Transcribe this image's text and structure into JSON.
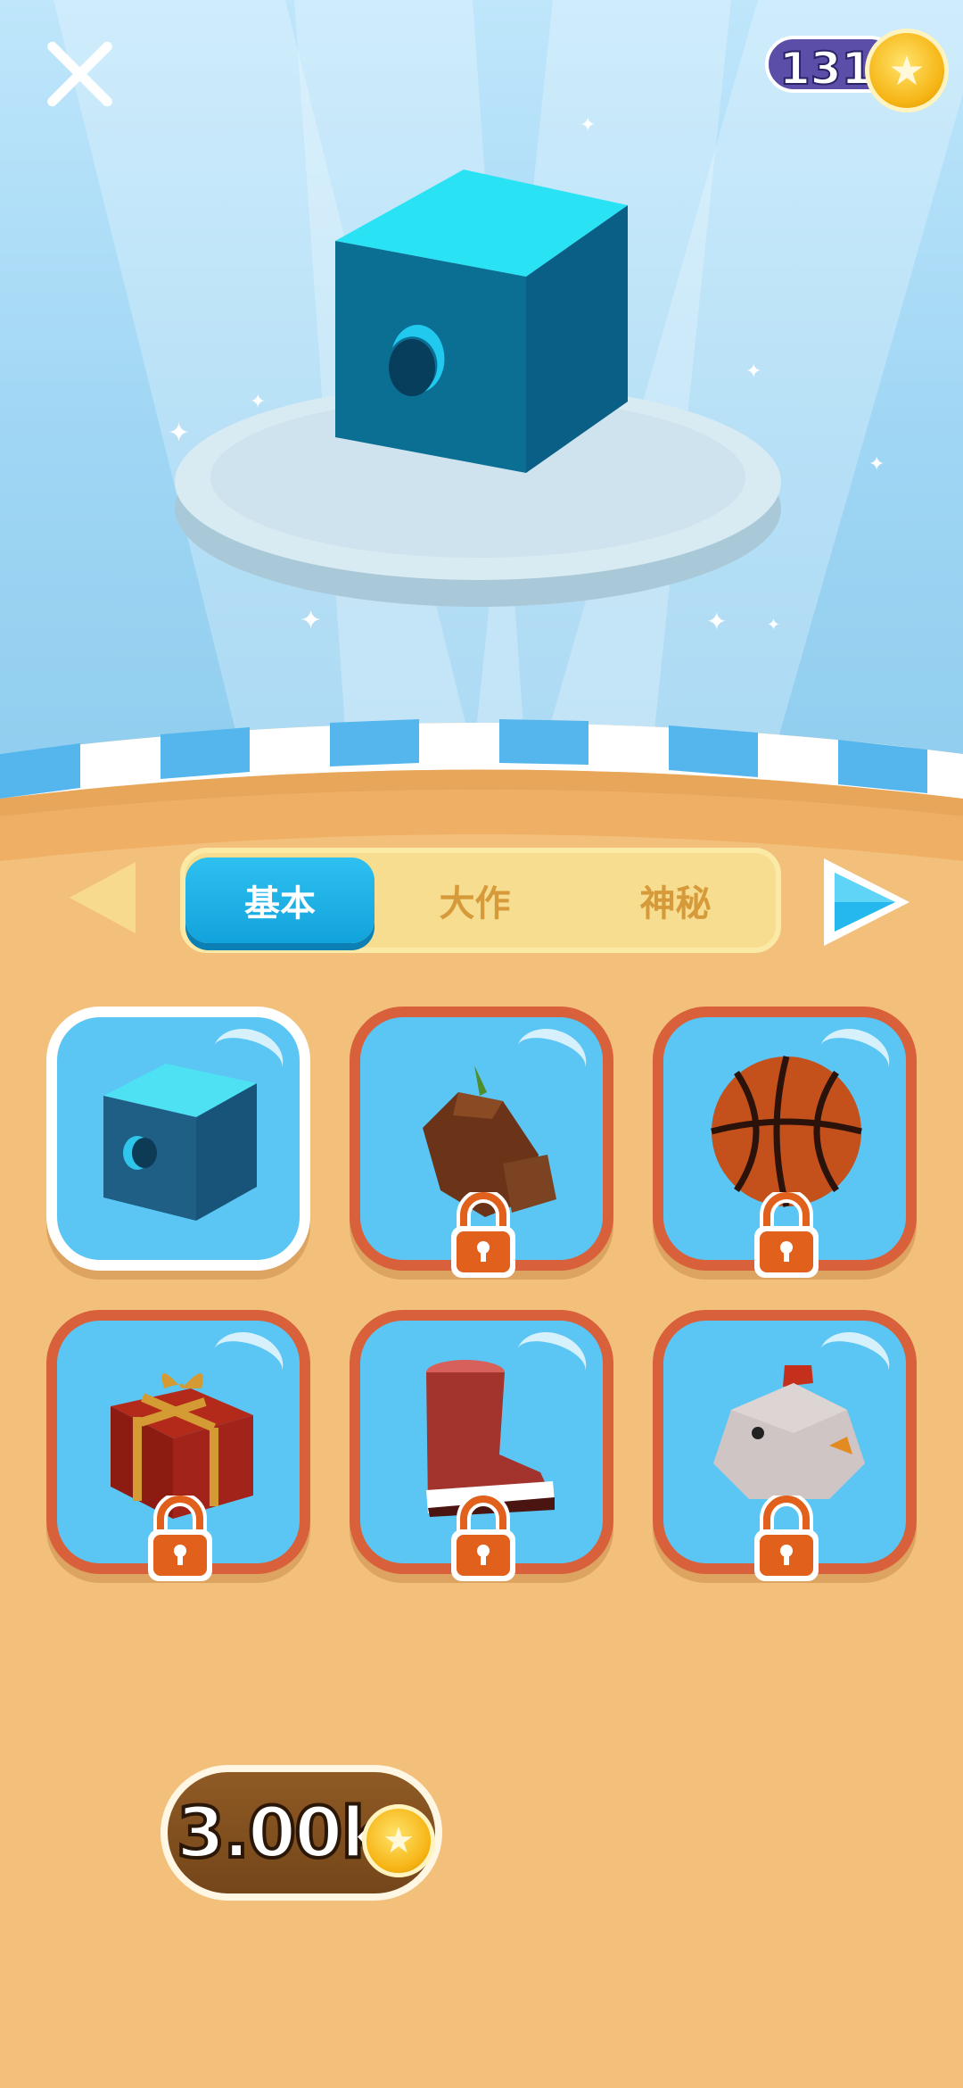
{
  "header": {
    "coins": "131",
    "coin_icon_glyph": "★"
  },
  "preview": {
    "item": "cube-icon"
  },
  "tabs": [
    {
      "label": "基本",
      "active": true
    },
    {
      "label": "大作",
      "active": false
    },
    {
      "label": "神秘",
      "active": false
    }
  ],
  "items": [
    {
      "name": "cube",
      "locked": false,
      "selected": true
    },
    {
      "name": "tree-stump",
      "locked": true,
      "selected": false
    },
    {
      "name": "basketball",
      "locked": true,
      "selected": false
    },
    {
      "name": "gift-box",
      "locked": true,
      "selected": false
    },
    {
      "name": "boot",
      "locked": true,
      "selected": false
    },
    {
      "name": "chicken",
      "locked": true,
      "selected": false
    }
  ],
  "buy": {
    "price": "3.00k"
  },
  "colors": {
    "card_border": "#d8613b",
    "card_fill": "#5bc6f3",
    "tab_active": "#12a3dc",
    "floor": "#f3c07c"
  }
}
